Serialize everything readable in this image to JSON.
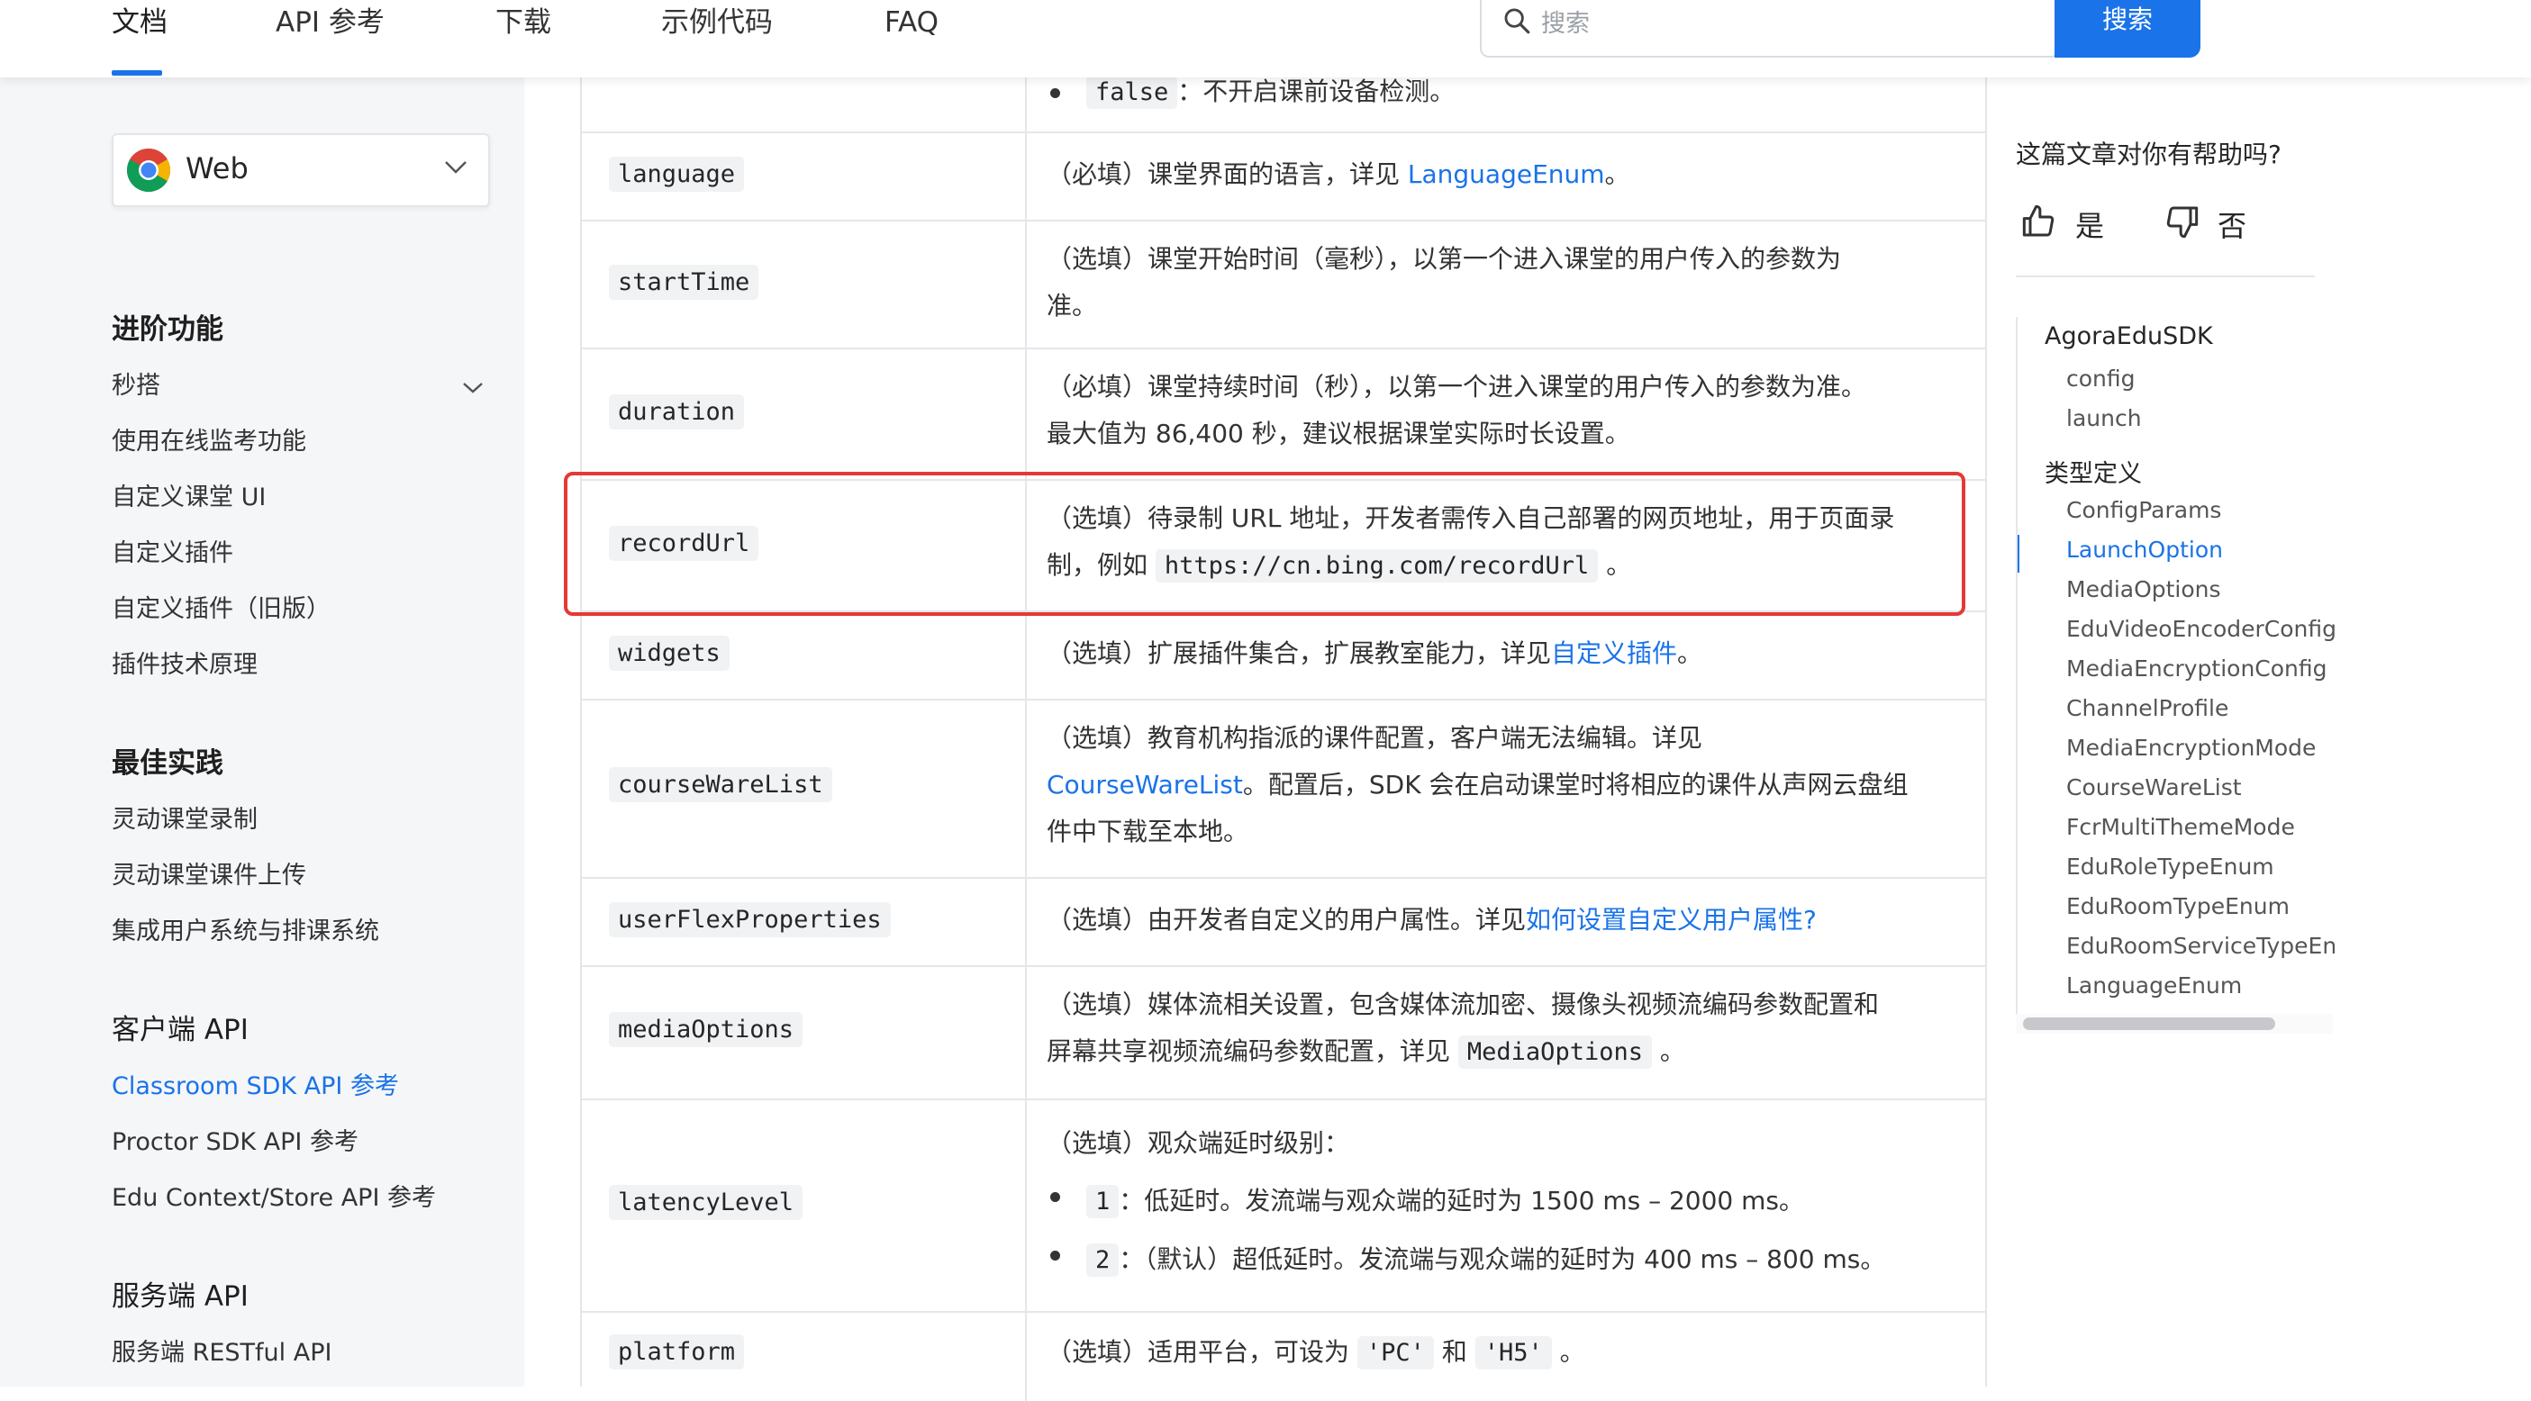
{
  "nav": {
    "items": [
      "文档",
      "API 参考",
      "下载",
      "示例代码",
      "FAQ"
    ],
    "search_placeholder": "搜索",
    "search_button": "搜索"
  },
  "sidebar": {
    "platform": "Web",
    "sections": [
      {
        "title": "进阶功能",
        "items": [
          "秒搭",
          "使用在线监考功能",
          "自定义课堂 UI",
          "自定义插件",
          "自定义插件（旧版）",
          "插件技术原理"
        ]
      },
      {
        "title": "最佳实践",
        "items": [
          "灵动课堂录制",
          "灵动课堂课件上传",
          "集成用户系统与排课系统"
        ]
      },
      {
        "title": "客户端 API",
        "items": [
          "Classroom SDK API 参考",
          "Proctor SDK API 参考",
          "Edu Context/Store API 参考"
        ]
      },
      {
        "title": "服务端 API",
        "items": [
          "服务端 RESTful API"
        ]
      }
    ]
  },
  "table": {
    "top_partial": {
      "code": "false",
      "text": "：不开启课前设备检测。"
    },
    "rows": {
      "language": {
        "param": "language",
        "pre": "（必填）课堂界面的语言，详见 ",
        "link": "LanguageEnum",
        "post": "。"
      },
      "startTime": {
        "param": "startTime",
        "line1": "（选填）课堂开始时间（毫秒），以第一个进入课堂的用户传入的参数为",
        "line2": "准。"
      },
      "duration": {
        "param": "duration",
        "line1": "（必填）课堂持续时间（秒），以第一个进入课堂的用户传入的参数为准。",
        "line2": "最大值为 86,400 秒，建议根据课堂实际时长设置。"
      },
      "recordUrl": {
        "param": "recordUrl",
        "line1": "（选填）待录制 URL 地址，开发者需传入自己部署的网页地址，用于页面录",
        "line2_pre": "制，例如 ",
        "code": "https://cn.bing.com/recordUrl",
        "line2_post": " 。"
      },
      "widgets": {
        "param": "widgets",
        "pre": "（选填）扩展插件集合，扩展教室能力，详见",
        "link": "自定义插件",
        "post": "。"
      },
      "courseWareList": {
        "param": "courseWareList",
        "line1": "（选填）教育机构指派的课件配置，客户端无法编辑。详见",
        "link": "CourseWareList",
        "line2_post": "。配置后，SDK 会在启动课堂时将相应的课件从声网云盘组",
        "line3": "件中下载至本地。"
      },
      "userFlexProperties": {
        "param": "userFlexProperties",
        "pre": "（选填）由开发者自定义的用户属性。详见",
        "link": "如何设置自定义用户属性?"
      },
      "mediaOptions": {
        "param": "mediaOptions",
        "line1": "（选填）媒体流相关设置，包含媒体流加密、摄像头视频流编码参数配置和",
        "line2_pre": "屏幕共享视频流编码参数配置，详见 ",
        "code": "MediaOptions",
        "line2_post": " 。"
      },
      "latencyLevel": {
        "param": "latencyLevel",
        "intro": "（选填）观众端延时级别：",
        "b1_code": "1",
        "b1_text": "：低延时。发流端与观众端的延时为 1500 ms – 2000 ms。",
        "b2_code": "2",
        "b2_text": "：（默认）超低延时。发流端与观众端的延时为 400 ms – 800 ms。"
      },
      "platform": {
        "param": "platform",
        "pre": "（选填）适用平台，可设为 ",
        "code1": "'PC'",
        "mid": " 和 ",
        "code2": "'H5'",
        "post": " 。"
      }
    }
  },
  "feedback": {
    "question": "这篇文章对你有帮助吗?",
    "yes": "是",
    "no": "否"
  },
  "toc": {
    "groups": [
      {
        "title": "AgoraEduSDK",
        "items": [
          "config",
          "launch"
        ]
      },
      {
        "title": "类型定义",
        "items": [
          "ConfigParams",
          "LaunchOption",
          "MediaOptions",
          "EduVideoEncoderConfigu",
          "MediaEncryptionConfig",
          "ChannelProfile",
          "MediaEncryptionMode",
          "CourseWareList",
          "FcrMultiThemeMode",
          "EduRoleTypeEnum",
          "EduRoomTypeEnum",
          "EduRoomServiceTypeEnu",
          "LanguageEnum"
        ]
      }
    ],
    "active": "LaunchOption"
  },
  "colors": {
    "accent": "#1a73e8",
    "highlight": "#e53935",
    "sidebar_bg": "#f5f6f8"
  }
}
